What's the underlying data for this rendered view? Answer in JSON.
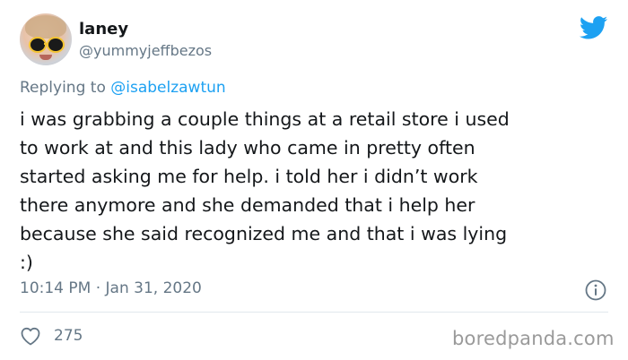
{
  "author": {
    "name": "laney",
    "handle": "@yummyjeffbezos"
  },
  "reply": {
    "prefix": "Replying to",
    "mention": "@isabelzawtun"
  },
  "tweet": {
    "text": "i was grabbing a couple things at a retail store i used\nto work at and this lady who came in pretty often\nstarted asking me for help. i told her i didn’t work\nthere anymore and she demanded that i help her\nbecause she said recognized me and that i was lying\n:)",
    "timestamp": "10:14 PM · Jan 31, 2020",
    "likes": "275"
  },
  "icons": {
    "brand": "twitter-bird-icon",
    "info": "info-icon",
    "like": "heart-icon"
  },
  "colors": {
    "twitter_blue": "#1da1f2",
    "muted_text": "#657786",
    "main_text": "#14171a"
  },
  "watermark": "boredpanda.com"
}
